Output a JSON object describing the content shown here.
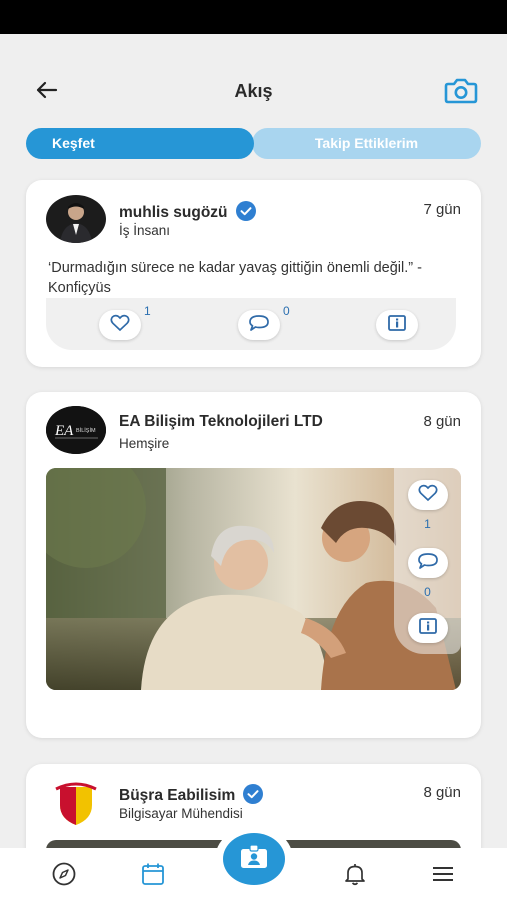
{
  "header": {
    "title": "Akış"
  },
  "tabs": [
    {
      "label": "Keşfet",
      "active": true
    },
    {
      "label": "Takip Ettiklerim",
      "active": false
    }
  ],
  "posts": [
    {
      "author": "muhlis sugözü",
      "verified": true,
      "role": "İş İnsanı",
      "time": "7 gün",
      "text": "‘Durmadığın sürece ne kadar yavaş gittiğin önemli değil.” - Konfiçyüs",
      "likes": "1",
      "comments": "0"
    },
    {
      "author": "EA Bilişim Teknolojileri LTD",
      "verified": false,
      "role": "Hemşire",
      "time": "8 gün",
      "logo_text": "EA",
      "logo_sub": "BİLİŞİM",
      "likes": "1",
      "comments": "0"
    },
    {
      "author": "Büşra Eabilisim",
      "verified": true,
      "role": "Bilgisayar Mühendisi",
      "time": "8 gün"
    }
  ],
  "bottom_nav": [
    "compass-icon",
    "calendar-icon",
    "profile-card-icon",
    "bell-icon",
    "menu-icon"
  ],
  "colors": {
    "accent": "#2696d6",
    "tab_inactive": "#a9d5ef",
    "background": "#efefef"
  }
}
